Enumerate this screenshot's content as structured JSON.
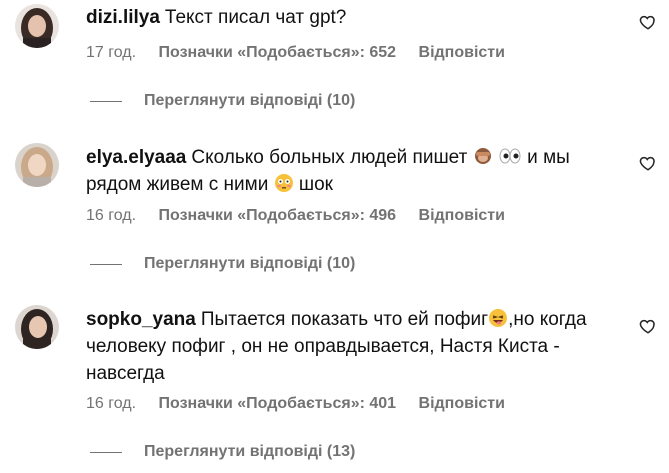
{
  "comments": [
    {
      "username": "dizi.lilya",
      "text_parts": [
        "Текст писал чат gpt?"
      ],
      "time": "17 год.",
      "likes_label": "Позначки «Подобається»: 652",
      "reply_label": "Відповісти",
      "view_replies": "Переглянути відповіді (10)"
    },
    {
      "username": "elya.elyaaa",
      "text_parts": [
        "Сколько больных людей пишет",
        "и мы",
        "рядом живем с ними",
        "шок"
      ],
      "emojis": [
        "see-no-evil-monkey",
        "eyes",
        "flushed-face"
      ],
      "time": "16 год.",
      "likes_label": "Позначки «Подобається»: 496",
      "reply_label": "Відповісти",
      "view_replies": "Переглянути відповіді (10)"
    },
    {
      "username": "sopko_yana",
      "text_parts": [
        "Пытается показать что ей пофиг",
        ",но когда человеку пофиг , он не оправдывается, Настя Киста - навсегда"
      ],
      "emojis": [
        "laughing-tongue-face"
      ],
      "time": "16 год.",
      "likes_label": "Позначки «Подобається»: 401",
      "reply_label": "Відповісти",
      "view_replies": "Переглянути відповіді (13)"
    }
  ]
}
